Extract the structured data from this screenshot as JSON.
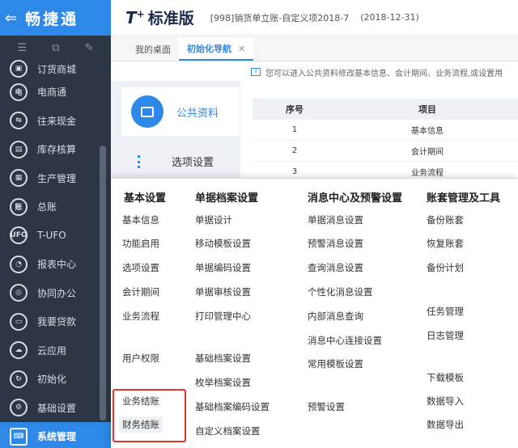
{
  "sidebar": {
    "brand": "畅捷通",
    "back_icon": "arrow-left-icon",
    "items": [
      {
        "label": "订货商城",
        "icon": "shop-icon",
        "glyph": "▣"
      },
      {
        "label": "电商通",
        "icon": "ecommerce-icon",
        "glyph": "电"
      },
      {
        "label": "往来现金",
        "icon": "cash-icon",
        "glyph": "⇆"
      },
      {
        "label": "库存核算",
        "icon": "inventory-icon",
        "glyph": "▤"
      },
      {
        "label": "生产管理",
        "icon": "production-icon",
        "glyph": "▦"
      },
      {
        "label": "总账",
        "icon": "ledger-icon",
        "glyph": "账"
      },
      {
        "label": "T-UFO",
        "icon": "ufo-icon",
        "glyph": "UFO"
      },
      {
        "label": "报表中心",
        "icon": "report-icon",
        "glyph": "◔"
      },
      {
        "label": "协同办公",
        "icon": "collab-icon",
        "glyph": "◎"
      },
      {
        "label": "我要贷款",
        "icon": "loan-icon",
        "glyph": "▭"
      },
      {
        "label": "云应用",
        "icon": "cloud-icon",
        "glyph": "☁"
      },
      {
        "label": "初始化",
        "icon": "init-icon",
        "glyph": "↻"
      },
      {
        "label": "基础设置",
        "icon": "settings-icon",
        "glyph": "⚙"
      },
      {
        "label": "系统管理",
        "icon": "system-icon",
        "glyph": "⌨"
      }
    ]
  },
  "header": {
    "logo": "T",
    "logo_sup": "+",
    "edition": "标准版",
    "account": "[998]销货单立账-自定义项2018-7",
    "date": "(2018-12-31)"
  },
  "tabs": [
    {
      "label": "我的桌面"
    },
    {
      "label": "初始化导航",
      "close": "✕"
    }
  ],
  "info": {
    "text": "您可以进入公共资料修改基本信息、会计期间、业务流程,或设置用"
  },
  "guide_nav": {
    "card_label": "公共资料",
    "option_label": "选项设置"
  },
  "table": {
    "headers": [
      "序号",
      "项目"
    ],
    "rows": [
      [
        "1",
        "基本信息"
      ],
      [
        "2",
        "会计期间"
      ],
      [
        "3",
        "业务流程"
      ]
    ]
  },
  "menu": {
    "col1": {
      "title": "基本设置",
      "items": [
        "基本信息",
        "功能启用",
        "选项设置",
        "会计期间",
        "业务流程",
        "用户权限",
        "业务结账",
        "财务结账"
      ]
    },
    "col2": {
      "title": "单据档案设置",
      "items": [
        "单据设计",
        "移动模板设置",
        "单据编码设置",
        "单据审核设置",
        "打印管理中心",
        "基础档案设置",
        "枚举档案设置",
        "基础档案编码设置",
        "自定义档案设置"
      ]
    },
    "col3": {
      "title": "消息中心及预警设置",
      "items": [
        "单据消息设置",
        "预警消息设置",
        "查询消息设置",
        "个性化消息设置",
        "内部消息查询",
        "消息中心连接设置",
        "常用模板设置",
        "预警设置"
      ]
    },
    "col4": {
      "title": "账套管理及工具",
      "items": [
        "备份账套",
        "恢复账套",
        "备份计划",
        "任务管理",
        "日志管理",
        "下载模板",
        "数据导入",
        "数据导出"
      ]
    }
  }
}
